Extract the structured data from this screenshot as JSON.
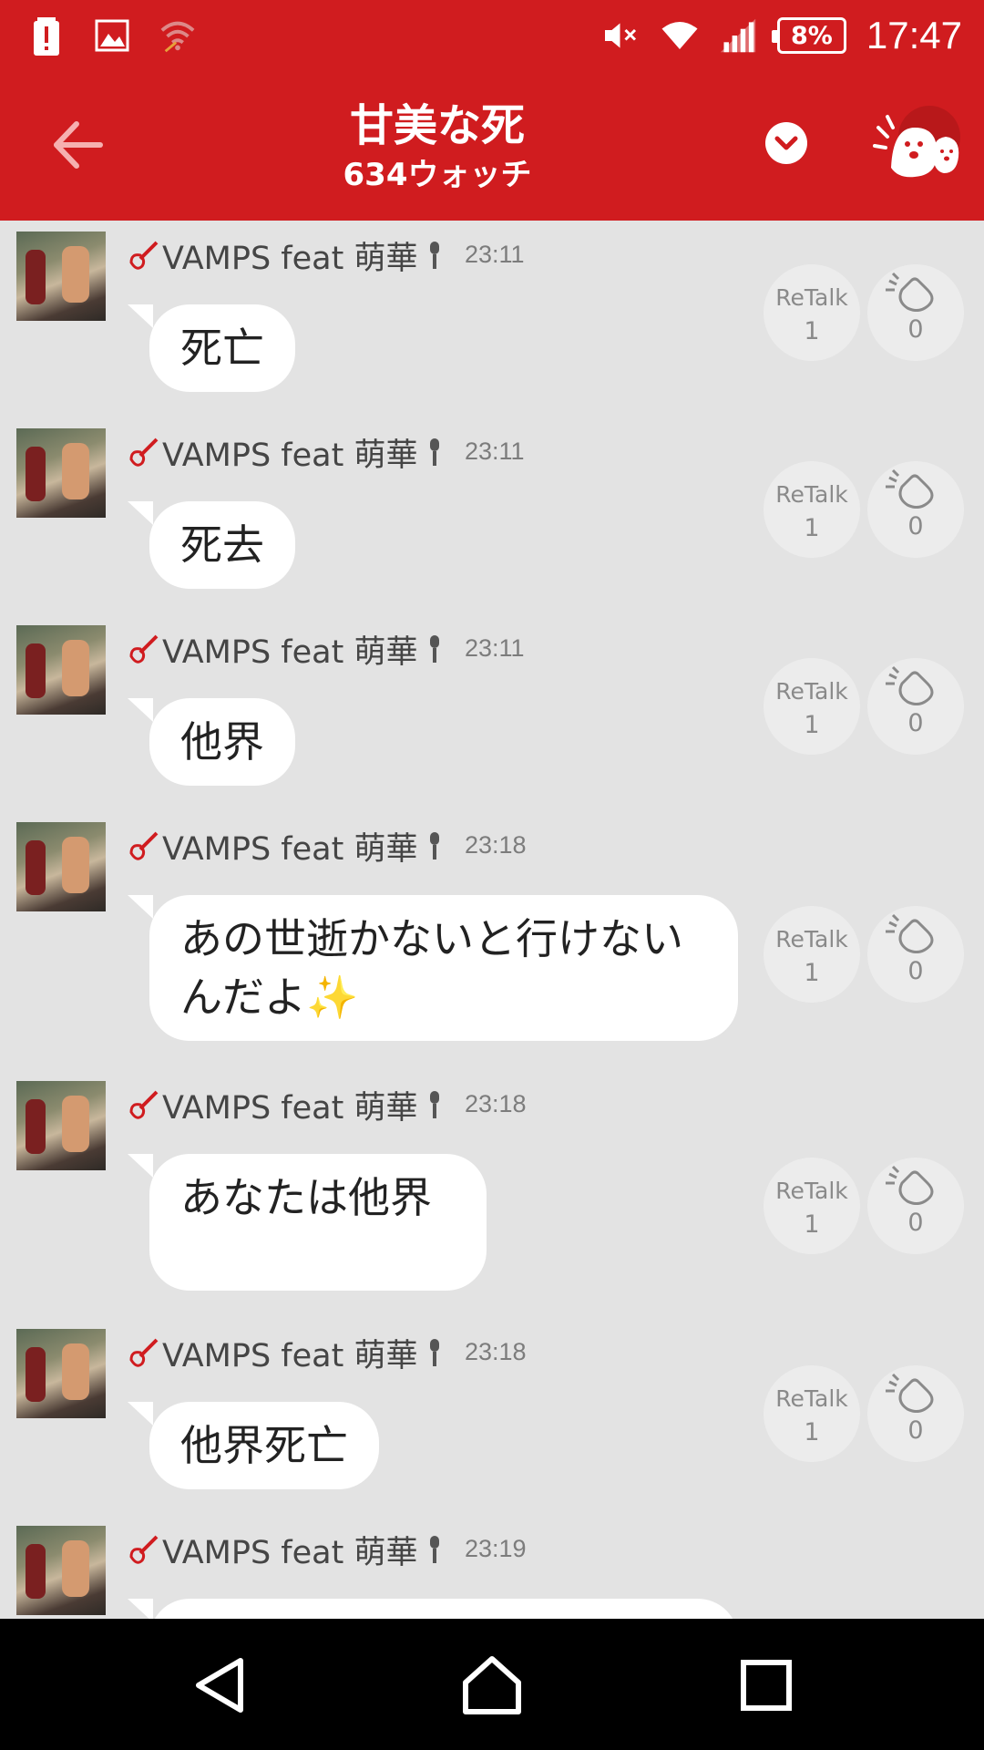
{
  "status_bar": {
    "battery_percent": "8%",
    "time": "17:47",
    "icons": [
      "battery-alert-icon",
      "image-icon",
      "wifi-off-icon",
      "volume-mute-icon",
      "wifi-icon",
      "signal-icon",
      "battery-icon"
    ]
  },
  "header": {
    "title": "甘美な死",
    "subtitle": "634ウォッチ",
    "back_icon": "arrow-left-icon",
    "dropdown_icon": "chevron-down-icon",
    "mascot_icon": "mascot-icon"
  },
  "messages": [
    {
      "author": "VAMPS feat 萌華",
      "time": "23:11",
      "text": "死亡",
      "retalk_label": "ReTalk",
      "retalk_count": "1",
      "clap_count": "0"
    },
    {
      "author": "VAMPS feat 萌華",
      "time": "23:11",
      "text": "死去",
      "retalk_label": "ReTalk",
      "retalk_count": "1",
      "clap_count": "0"
    },
    {
      "author": "VAMPS feat 萌華",
      "time": "23:11",
      "text": "他界",
      "retalk_label": "ReTalk",
      "retalk_count": "1",
      "clap_count": "0"
    },
    {
      "author": "VAMPS feat 萌華",
      "time": "23:18",
      "text": "あの世逝かないと行けないんだよ✨",
      "retalk_label": "ReTalk",
      "retalk_count": "1",
      "clap_count": "0"
    },
    {
      "author": "VAMPS feat 萌華",
      "time": "23:18",
      "text": "あなたは他界",
      "retalk_label": "ReTalk",
      "retalk_count": "1",
      "clap_count": "0"
    },
    {
      "author": "VAMPS feat 萌華",
      "time": "23:18",
      "text": "他界死亡",
      "retalk_label": "ReTalk",
      "retalk_count": "1",
      "clap_count": "0"
    },
    {
      "author": "VAMPS feat 萌華",
      "time": "23:19",
      "text": ""
    }
  ],
  "colors": {
    "header_red": "#d01c1f",
    "background": "#e3e3e3",
    "bubble": "#ffffff",
    "guitar_red": "#d01c1f"
  },
  "nav": {
    "back_icon": "nav-back-icon",
    "home_icon": "nav-home-icon",
    "recents_icon": "nav-recents-icon"
  }
}
